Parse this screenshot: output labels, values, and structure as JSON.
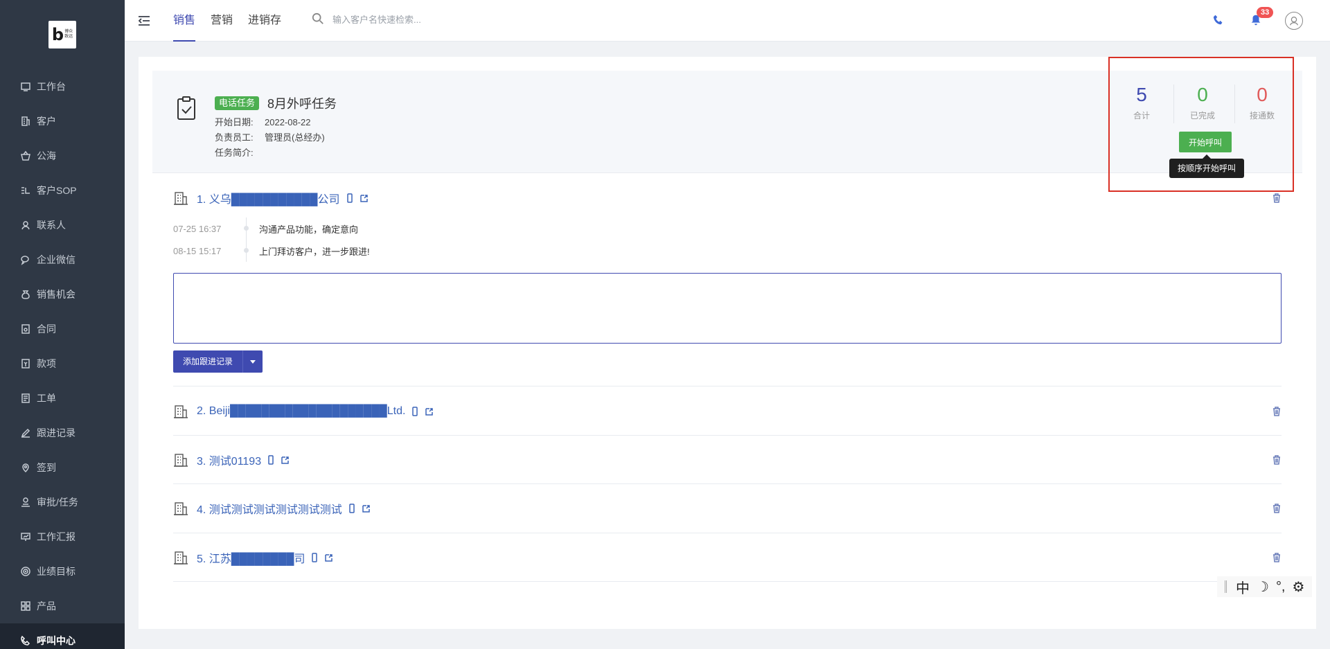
{
  "brand": {
    "logo_text_1": "博众",
    "logo_text_2": "致远"
  },
  "sidebar": {
    "items": [
      {
        "label": "工作台",
        "icon": "desktop-icon"
      },
      {
        "label": "客户",
        "icon": "building-icon"
      },
      {
        "label": "公海",
        "icon": "basket-icon"
      },
      {
        "label": "客户SOP",
        "icon": "sop-icon"
      },
      {
        "label": "联系人",
        "icon": "contact-icon"
      },
      {
        "label": "企业微信",
        "icon": "wechat-icon"
      },
      {
        "label": "销售机会",
        "icon": "moneybag-icon"
      },
      {
        "label": "合同",
        "icon": "contract-icon"
      },
      {
        "label": "款项",
        "icon": "payment-icon"
      },
      {
        "label": "工单",
        "icon": "ticket-icon"
      },
      {
        "label": "跟进记录",
        "icon": "edit-icon"
      },
      {
        "label": "签到",
        "icon": "location-icon"
      },
      {
        "label": "审批/任务",
        "icon": "approval-icon"
      },
      {
        "label": "工作汇报",
        "icon": "report-icon"
      },
      {
        "label": "业绩目标",
        "icon": "target-icon"
      },
      {
        "label": "产品",
        "icon": "grid-icon"
      },
      {
        "label": "呼叫中心",
        "icon": "call-center-icon",
        "active": true
      }
    ]
  },
  "topbar": {
    "tabs": [
      {
        "label": "销售",
        "active": true
      },
      {
        "label": "营销"
      },
      {
        "label": "进销存"
      }
    ],
    "search_placeholder": "输入客户名快速检索...",
    "notification_count": "33"
  },
  "task": {
    "tag": "电话任务",
    "title": "8月外呼任务",
    "start_date_label": "开始日期:",
    "start_date": "2022-08-22",
    "owner_label": "负责员工:",
    "owner": "管理员(总经办)",
    "intro_label": "任务简介:",
    "intro": ""
  },
  "stats": {
    "total": {
      "value": "5",
      "label": "合计",
      "color": "#3f4ab0"
    },
    "done": {
      "value": "0",
      "label": "已完成",
      "color": "#4caf50"
    },
    "connected": {
      "value": "0",
      "label": "接通数",
      "color": "#e05a5a"
    },
    "start_button": "开始呼叫",
    "tooltip": "按顺序开始呼叫"
  },
  "customers": [
    {
      "name": "1. 义乌███████████公司"
    },
    {
      "name": "2. Beiji████████████████████Ltd."
    },
    {
      "name": "3. 测试01193"
    },
    {
      "name": "4. 测试测试测试测试测试测试"
    },
    {
      "name": "5. 江苏████████司"
    }
  ],
  "followups": [
    {
      "time": "07-25 16:37",
      "text": "沟通产品功能，确定意向"
    },
    {
      "time": "08-15 15:17",
      "text": "上门拜访客户，进一步跟进!"
    }
  ],
  "note": {
    "value": ""
  },
  "add_button": "添加跟进记录",
  "ime": {
    "mode": "中",
    "punct": "°,"
  }
}
